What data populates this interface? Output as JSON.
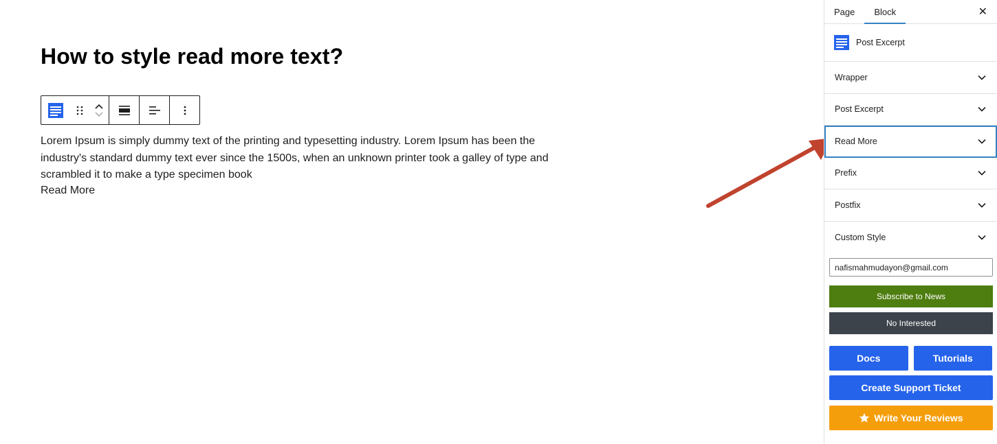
{
  "post": {
    "title": "How to style read more text?",
    "excerpt": "Lorem Ipsum is simply dummy text of the printing and typesetting industry. Lorem Ipsum has been the industry's standard dummy text ever since the 1500s, when an unknown printer took a galley of type and scrambled it to make a type specimen book",
    "read_more": "Read More"
  },
  "toolbar": {
    "icons": [
      "post-excerpt-block-icon",
      "drag-handle-icon",
      "move-up-icon",
      "move-down-icon",
      "align-full-width-icon",
      "text-align-left-icon",
      "more-options-icon"
    ]
  },
  "sidebar": {
    "tabs": [
      "Page",
      "Block"
    ],
    "active_tab": "Block",
    "close_glyph": "✕",
    "block_name": "Post Excerpt",
    "panels": [
      "Wrapper",
      "Post Excerpt",
      "Read More",
      "Prefix",
      "Postfix",
      "Custom Style"
    ],
    "focused_panel": "Read More",
    "email_value": "nafismahmudayon@gmail.com",
    "subscribe_label": "Subscribe to News",
    "no_interest_label": "No Interested",
    "docs_label": "Docs",
    "tutorials_label": "Tutorials",
    "support_label": "Create Support Ticket",
    "review_label": "Write Your Reviews"
  },
  "colors": {
    "accent_blue": "#2563eb",
    "focus_outline": "#3582c4",
    "subscribe_green": "#4e7d10",
    "no_interest_gray": "#3c434a",
    "review_orange": "#f59e0b",
    "annotation_arrow": "#c0432e"
  }
}
